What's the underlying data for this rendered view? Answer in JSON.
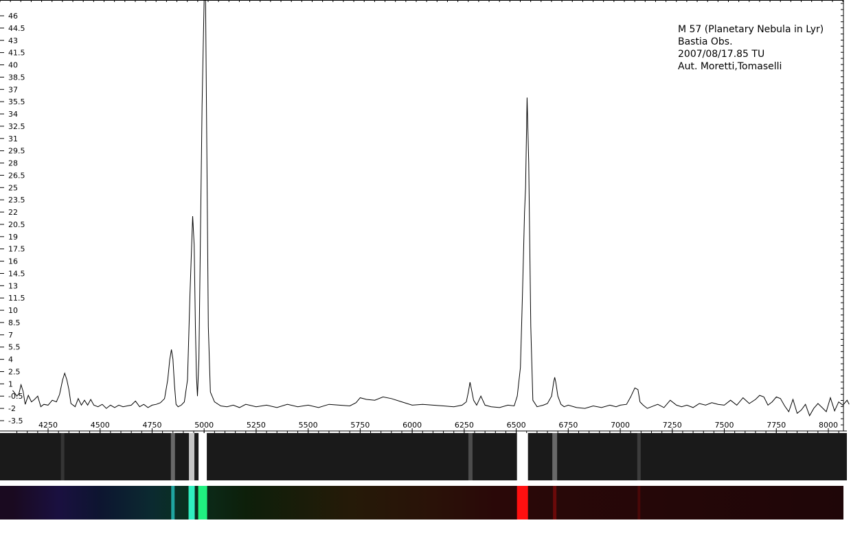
{
  "annotation": {
    "lines": [
      "M 57 (Planetary Nebula in Lyr)",
      "Bastia Obs.",
      "2007/08/17.85 TU",
      "Aut. Moretti,Tomaselli"
    ]
  },
  "chart_data": {
    "type": "line",
    "title": "",
    "xlabel": "",
    "ylabel": "",
    "xlim": [
      4080,
      8100
    ],
    "ylim": [
      -3.5,
      48
    ],
    "grid": false,
    "legend": "none",
    "x_ticks": [
      4250,
      4500,
      4750,
      5000,
      5250,
      5500,
      5750,
      6000,
      6250,
      6500,
      6750,
      7000,
      7250,
      7500,
      7750,
      8000
    ],
    "y_ticks": [
      "46",
      "44.5",
      "43",
      "41.5",
      "40",
      "38.5",
      "37",
      "35.5",
      "34",
      "32.5",
      "31",
      "29.5",
      "28",
      "26.5",
      "25",
      "23.5",
      "22",
      "20.5",
      "19",
      "17.5",
      "16",
      "14.5",
      "13",
      "11.5",
      "10",
      "8.5",
      "7",
      "5.5",
      "4",
      "2.5",
      "1",
      "-0.5",
      "-2",
      "-3.5"
    ],
    "series": [
      {
        "x": [
          4080,
          4100,
          4110,
          4120,
          4130,
          4140,
          4155,
          4170,
          4185,
          4200,
          4215,
          4230,
          4250,
          4270,
          4290,
          4305,
          4320,
          4330,
          4340,
          4350,
          4360,
          4380,
          4395,
          4410,
          4425,
          4440,
          4455,
          4470,
          4490,
          4510,
          4530,
          4550,
          4570,
          4590,
          4610,
          4630,
          4650,
          4670,
          4690,
          4710,
          4730,
          4750,
          4770,
          4790,
          4810,
          4825,
          4835,
          4843,
          4850,
          4857,
          4865,
          4875,
          4890,
          4905,
          4920,
          4932,
          4945,
          4952,
          4958,
          4963,
          4968,
          4975,
          4990,
          5000,
          5007,
          5013,
          5020,
          5030,
          5050,
          5080,
          5110,
          5140,
          5170,
          5200,
          5250,
          5300,
          5350,
          5400,
          5450,
          5500,
          5550,
          5600,
          5650,
          5700,
          5730,
          5750,
          5780,
          5820,
          5860,
          5900,
          5950,
          6000,
          6050,
          6100,
          6150,
          6200,
          6240,
          6260,
          6270,
          6278,
          6285,
          6295,
          6310,
          6330,
          6350,
          6380,
          6420,
          6460,
          6490,
          6505,
          6520,
          6530,
          6540,
          6545,
          6552,
          6560,
          6570,
          6580,
          6600,
          6630,
          6650,
          6670,
          6680,
          6685,
          6690,
          6700,
          6715,
          6730,
          6750,
          6790,
          6830,
          6870,
          6910,
          6950,
          6980,
          7000,
          7030,
          7050,
          7070,
          7085,
          7095,
          7110,
          7130,
          7150,
          7180,
          7210,
          7240,
          7270,
          7295,
          7320,
          7350,
          7380,
          7410,
          7440,
          7470,
          7500,
          7530,
          7560,
          7590,
          7620,
          7650,
          7670,
          7690,
          7710,
          7730,
          7750,
          7770,
          7790,
          7810,
          7830,
          7850,
          7870,
          7890,
          7910,
          7930,
          7950,
          7970,
          7990,
          8010,
          8030,
          8050,
          8070,
          8090,
          8100
        ],
        "y": [
          0.2,
          -0.5,
          -0.2,
          0.9,
          0.1,
          -1.5,
          -0.4,
          -1.2,
          -0.9,
          -0.5,
          -1.8,
          -1.5,
          -1.6,
          -1,
          -1.2,
          -0.3,
          1.5,
          2.3,
          1.5,
          0.3,
          -1.4,
          -1.8,
          -0.8,
          -1.6,
          -1,
          -1.6,
          -0.9,
          -1.6,
          -1.8,
          -1.5,
          -2,
          -1.6,
          -1.9,
          -1.6,
          -1.8,
          -1.7,
          -1.6,
          -1.1,
          -1.8,
          -1.5,
          -1.9,
          -1.6,
          -1.5,
          -1.3,
          -0.8,
          1.5,
          4,
          5.2,
          4,
          1,
          -1.5,
          -1.8,
          -1.6,
          -1.2,
          1.5,
          12,
          21.5,
          18,
          8,
          2,
          -0.5,
          4,
          35,
          50,
          50,
          30,
          8,
          0,
          -1.2,
          -1.7,
          -1.8,
          -1.6,
          -1.9,
          -1.5,
          -1.8,
          -1.6,
          -1.9,
          -1.5,
          -1.8,
          -1.6,
          -1.9,
          -1.5,
          -1.6,
          -1.7,
          -1.3,
          -0.7,
          -0.9,
          -1,
          -0.6,
          -0.8,
          -1.2,
          -1.6,
          -1.5,
          -1.6,
          -1.7,
          -1.8,
          -1.6,
          -1.2,
          0,
          1.2,
          0.3,
          -1,
          -1.6,
          -0.5,
          -1.6,
          -1.8,
          -1.9,
          -1.6,
          -1.7,
          -0.5,
          3,
          12,
          22,
          25,
          36,
          28,
          8,
          -1,
          -1.8,
          -1.6,
          -1.4,
          -0.5,
          1.2,
          1.8,
          1.2,
          -0.5,
          -1.5,
          -1.8,
          -1.6,
          -1.9,
          -2,
          -1.7,
          -1.9,
          -1.6,
          -1.8,
          -1.6,
          -1.5,
          -0.6,
          0.5,
          0.3,
          -1.2,
          -1.6,
          -2,
          -1.8,
          -1.5,
          -1.9,
          -1,
          -1.6,
          -1.8,
          -1.6,
          -1.9,
          -1.4,
          -1.6,
          -1.3,
          -1.5,
          -1.6,
          -1,
          -1.6,
          -0.7,
          -1.4,
          -0.9,
          -0.4,
          -0.6,
          -1.6,
          -1.2,
          -0.6,
          -0.8,
          -1.7,
          -2.4,
          -0.9,
          -2.6,
          -2.2,
          -1.5,
          -2.9,
          -2,
          -1.4,
          -1.9,
          -2.4,
          -0.7,
          -2.3,
          -1.2,
          -1.6,
          -1,
          -1.5
        ]
      }
    ]
  },
  "strips": {
    "gray_background": "#1a1a1a",
    "gray_lines": [
      {
        "x": 4850,
        "w": 6,
        "a": 0.35
      },
      {
        "x": 4320,
        "w": 5,
        "a": 0.12
      },
      {
        "x": 4940,
        "w": 8,
        "a": 0.75
      },
      {
        "x": 4993,
        "w": 12,
        "a": 1.0
      },
      {
        "x": 6280,
        "w": 6,
        "a": 0.22
      },
      {
        "x": 6530,
        "w": 16,
        "a": 1.0
      },
      {
        "x": 6685,
        "w": 7,
        "a": 0.35
      },
      {
        "x": 7090,
        "w": 5,
        "a": 0.15
      }
    ],
    "color_gradient": [
      {
        "x": 4080,
        "c": "#1a0a20"
      },
      {
        "x": 4300,
        "c": "#1a1040"
      },
      {
        "x": 4500,
        "c": "#0d1530"
      },
      {
        "x": 4750,
        "c": "#0b2a30"
      },
      {
        "x": 4900,
        "c": "#0a3020"
      },
      {
        "x": 5200,
        "c": "#0d1f0a"
      },
      {
        "x": 5700,
        "c": "#251a08"
      },
      {
        "x": 6100,
        "c": "#2a1208"
      },
      {
        "x": 6400,
        "c": "#2a0808"
      },
      {
        "x": 8100,
        "c": "#1f0608"
      }
    ],
    "color_lines": [
      {
        "x": 4850,
        "w": 5,
        "c": "#1fa5a0"
      },
      {
        "x": 4940,
        "w": 9,
        "c": "#30f0c0"
      },
      {
        "x": 4993,
        "w": 13,
        "c": "#20f080"
      },
      {
        "x": 6530,
        "w": 16,
        "c": "#ff1010"
      },
      {
        "x": 6685,
        "w": 5,
        "c": "#6a0a0a"
      },
      {
        "x": 7090,
        "w": 4,
        "c": "#4a0808"
      }
    ]
  }
}
